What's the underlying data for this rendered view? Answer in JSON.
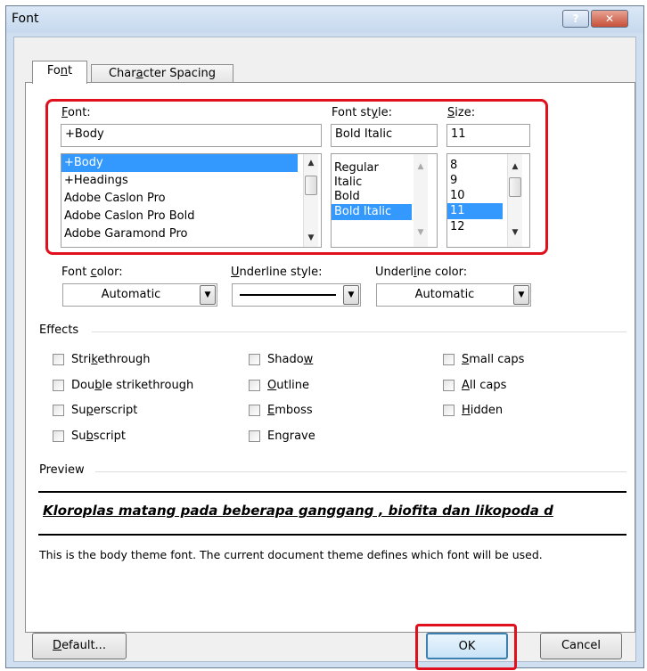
{
  "window": {
    "title": "Font",
    "help_label": "?",
    "close_label": "✕"
  },
  "tabs": [
    {
      "label": "Font",
      "active": true
    },
    {
      "label": "Character Spacing",
      "active": false
    }
  ],
  "font": {
    "label": "Font:",
    "value": "+Body",
    "items": [
      "+Body",
      "+Headings",
      "Adobe Caslon Pro",
      "Adobe Caslon Pro Bold",
      "Adobe Garamond Pro"
    ]
  },
  "font_style": {
    "label": "Font style:",
    "value": "Bold Italic",
    "items": [
      "Regular",
      "Italic",
      "Bold",
      "Bold Italic"
    ]
  },
  "size": {
    "label": "Size:",
    "value": "11",
    "items": [
      "8",
      "9",
      "10",
      "11",
      "12"
    ]
  },
  "font_color": {
    "label": "Font color:",
    "value": "Automatic"
  },
  "underline_style": {
    "label": "Underline style:"
  },
  "underline_color": {
    "label": "Underline color:",
    "value": "Automatic"
  },
  "effects": {
    "heading": "Effects",
    "col1": [
      "Strikethrough",
      "Double strikethrough",
      "Superscript",
      "Subscript"
    ],
    "col2": [
      "Shadow",
      "Outline",
      "Emboss",
      "Engrave"
    ],
    "col3": [
      "Small caps",
      "All caps",
      "Hidden"
    ]
  },
  "preview": {
    "heading": "Preview",
    "sample": "Kloroplas matang pada beberapa ganggang , biofita dan likopoda d",
    "description": "This is the body theme font. The current document theme defines which font will be used."
  },
  "buttons": {
    "default": "Default...",
    "ok": "OK",
    "cancel": "Cancel"
  },
  "colors": {
    "highlight": "#e0101c",
    "selection": "#3399ff"
  }
}
